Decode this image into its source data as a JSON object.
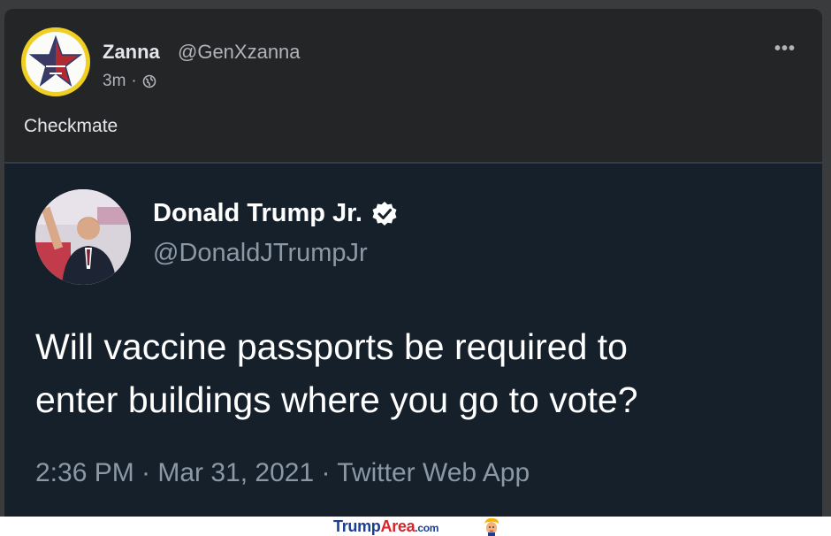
{
  "post": {
    "author_name": "Zanna",
    "author_handle": "@GenXzanna",
    "timestamp": "3m",
    "separator": "·",
    "audience_icon": "globe-icon",
    "more_icon": "more-options-icon",
    "more_label": "•••",
    "text": "Checkmate"
  },
  "tweet": {
    "author_name": "Donald Trump Jr.",
    "verified_icon": "verified-badge-icon",
    "author_handle": "@DonaldJTrumpJr",
    "line1": "Will vaccine passports be required to",
    "line2": "enter buildings where you go to vote?",
    "meta": "2:36 PM · Mar 31, 2021 · Twitter Web App"
  },
  "footer": {
    "brand_part1": "Trump",
    "brand_part2": "Area",
    "brand_suffix": ".com",
    "brand_icon": "trump-caricature-icon"
  },
  "colors": {
    "frame": "#3a3b3d",
    "post_bg": "#242526",
    "tweet_bg": "#15202b",
    "brand": "#1c3e94",
    "brand_accent": "#d6242a"
  }
}
